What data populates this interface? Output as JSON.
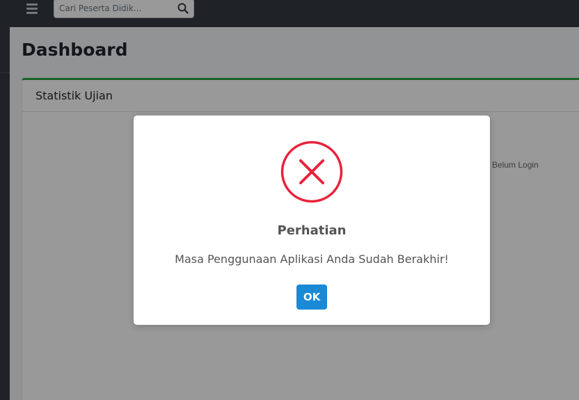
{
  "topbar": {
    "search": {
      "placeholder": "Cari Peserta Didik...",
      "value": ""
    },
    "icons": {
      "menu": "hamburger-icon",
      "search": "search-icon"
    }
  },
  "main": {
    "page_title": "Dashboard",
    "card": {
      "title": "Statistik Ujian",
      "accent_color": "#28a745",
      "legend_label": "Belum Login"
    }
  },
  "dialog": {
    "icon": "error-x-icon",
    "icon_color": "#f27474",
    "title": "Perhatian",
    "message": "Masa Penggunaan Aplikasi Anda Sudah Berakhir!",
    "confirm_label": "OK",
    "confirm_color": "#1a8ad6"
  }
}
